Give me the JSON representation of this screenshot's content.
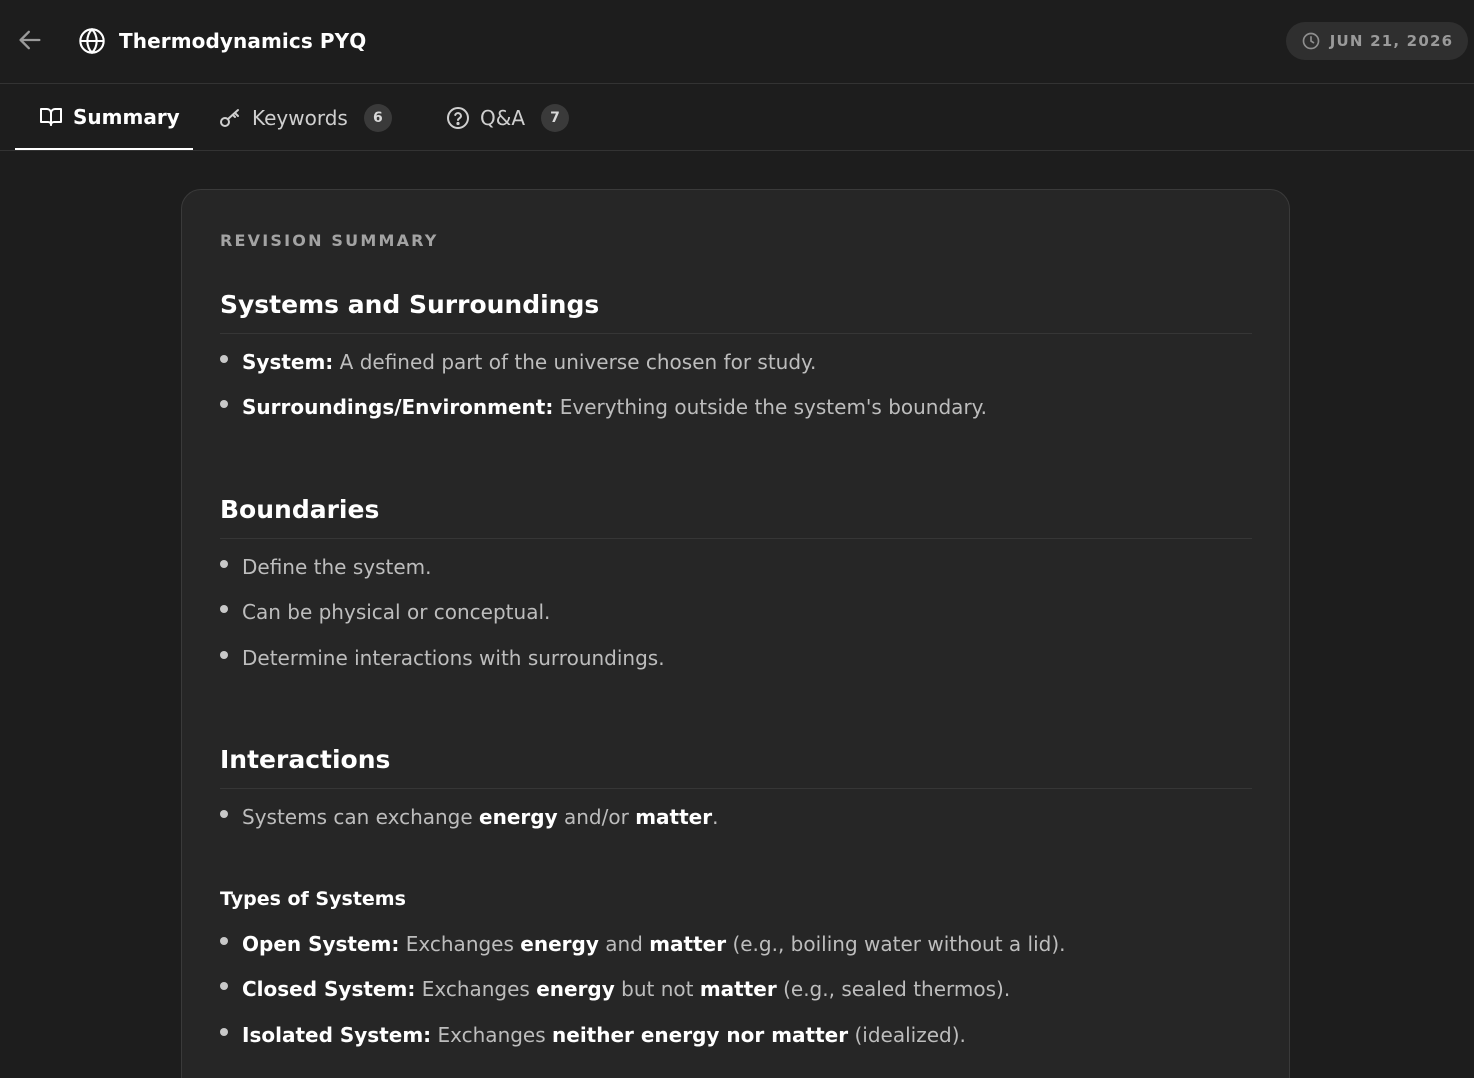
{
  "header": {
    "title": "Thermodynamics PYQ",
    "date": "JUN 21, 2026"
  },
  "tabs": [
    {
      "label": "Summary",
      "count": null,
      "active": true
    },
    {
      "label": "Keywords",
      "count": "6",
      "active": false
    },
    {
      "label": "Q&A",
      "count": "7",
      "active": false
    }
  ],
  "summary": {
    "eyebrow": "REVISION SUMMARY",
    "sections": {
      "systems": {
        "heading": "Systems and Surroundings",
        "items": [
          {
            "term": "System:",
            "text": " A defined part of the universe chosen for study."
          },
          {
            "term": "Surroundings/Environment:",
            "text": " Everything outside the system's boundary."
          }
        ]
      },
      "boundaries": {
        "heading": "Boundaries",
        "items": [
          "Define the system.",
          "Can be physical or conceptual.",
          "Determine interactions with surroundings."
        ]
      },
      "interactions": {
        "heading": "Interactions",
        "line": {
          "a": "Systems can exchange ",
          "b": "energy",
          "c": " and/or ",
          "d": "matter",
          "e": "."
        },
        "subheading": "Types of Systems",
        "types": [
          {
            "term": "Open System:",
            "t1": " Exchanges ",
            "b1": "energy",
            "t2": " and ",
            "b2": "matter",
            "t3": " (e.g., boiling water without a lid)."
          },
          {
            "term": "Closed System:",
            "t1": " Exchanges ",
            "b1": "energy",
            "t2": " but not ",
            "b2": "matter",
            "t3": " (e.g., sealed thermos)."
          },
          {
            "term": "Isolated System:",
            "t1": " Exchanges ",
            "b1": "neither energy nor matter",
            "t2": "",
            "b2": "",
            "t3": " (idealized)."
          }
        ]
      }
    }
  }
}
